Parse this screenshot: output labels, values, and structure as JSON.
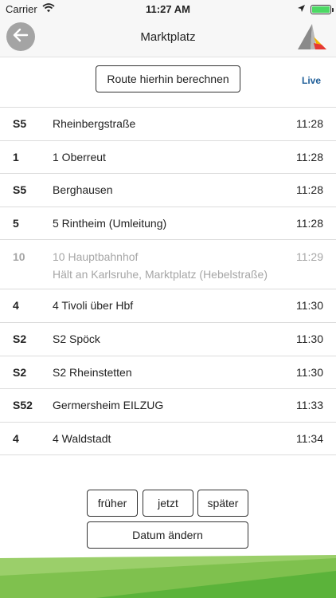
{
  "status_bar": {
    "carrier": "Carrier",
    "time": "11:27 AM"
  },
  "nav": {
    "title": "Marktplatz",
    "back_icon": "back-arrow-icon",
    "logo_icon": "kvv-logo-icon"
  },
  "route_button_label": "Route hierhin berechnen",
  "live_label": "Live",
  "departures": [
    {
      "line": "S5",
      "destination": "Rheinbergstraße",
      "time": "11:28"
    },
    {
      "line": "1",
      "destination": "1 Oberreut",
      "time": "11:28"
    },
    {
      "line": "S5",
      "destination": "Berghausen",
      "time": "11:28"
    },
    {
      "line": "5",
      "destination": "5 Rintheim (Umleitung)",
      "time": "11:28"
    },
    {
      "line": "10",
      "destination": "10 Hauptbahnhof",
      "note": "Hält an Karlsruhe, Marktplatz (Hebelstraße)",
      "time": "11:29",
      "muted": true
    },
    {
      "line": "4",
      "destination": "4 Tivoli über Hbf",
      "time": "11:30"
    },
    {
      "line": "S2",
      "destination": "S2 Spöck",
      "time": "11:30"
    },
    {
      "line": "S2",
      "destination": "S2 Rheinstetten",
      "time": "11:30"
    },
    {
      "line": "S52",
      "destination": "Germersheim EILZUG",
      "time": "11:33"
    },
    {
      "line": "4",
      "destination": "4 Waldstadt",
      "time": "11:34"
    }
  ],
  "buttons": {
    "earlier": "früher",
    "now": "jetzt",
    "later": "später",
    "change_date": "Datum ändern"
  },
  "colors": {
    "live_blue": "#1d5d98",
    "muted_gray": "#a6a6a6",
    "footer_green_light": "#9bcf6a",
    "footer_green_dark": "#5bb33a",
    "battery_green": "#4cd964"
  }
}
